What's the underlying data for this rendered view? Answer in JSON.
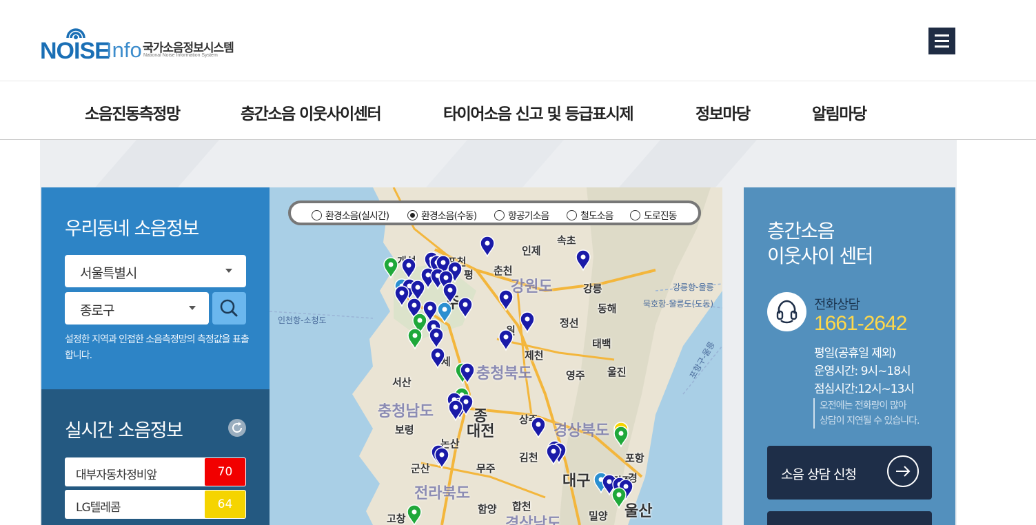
{
  "brand": {
    "logo_noise": "NOISE",
    "logo_info": "Info",
    "logo_ko": "국가소음정보시스템",
    "logo_en": "National Noise Information System"
  },
  "nav": {
    "items": [
      "소음진동측정망",
      "층간소음 이웃사이센터",
      "타이어소음 신고 및 등급표시제",
      "정보마당",
      "알림마당"
    ]
  },
  "local": {
    "title": "우리동네 소음정보",
    "city_select": "서울특별시",
    "district_select": "종로구",
    "help_text": "설정한 지역과 인접한 소음측정망의 측정값을 표출합니다."
  },
  "realtime": {
    "title": "실시간 소음정보",
    "rows": [
      {
        "name": "대부자동차정비앞",
        "value": "70",
        "color": "#f20000"
      },
      {
        "name": "LG텔레콤",
        "value": "64",
        "color": "#f5d400"
      }
    ]
  },
  "map": {
    "options": [
      "환경소음(실시간)",
      "환경소음(수동)",
      "항공기소음",
      "철도소음",
      "도로진동"
    ],
    "selected_option": "환경소음(수동)",
    "places": [
      "개성",
      "포천",
      "춘천",
      "인제",
      "속초",
      "강릉",
      "동해",
      "원",
      "정선",
      "태백",
      "제천",
      "영주",
      "울진",
      "서산",
      "보령",
      "논산",
      "상주",
      "대전",
      "김천",
      "포항",
      "대구",
      "군산",
      "무주",
      "함양",
      "합천",
      "밀양",
      "울산",
      "경주",
      "고창"
    ],
    "regions": [
      "강원도",
      "충청북도",
      "충청남도",
      "경상북도",
      "전라북도",
      "경상남도"
    ],
    "sea_routes": [
      "인천항-소청도",
      "강릉항-울릉",
      "묵호항-울릉도(도동)",
      "포항구-울릉"
    ],
    "label_fragments": [
      "평",
      "종",
      "세",
      "주",
      "경"
    ]
  },
  "center": {
    "title_line1": "층간소음",
    "title_line2": "이웃사이 센터",
    "phone_label": "전화상담",
    "phone": "1661-2642",
    "hours": [
      "평일(공휴일 제외)",
      "운영시간: 9시~18시",
      "점심시간:12시~13시"
    ],
    "note": [
      "오전에는 전화량이 많아",
      "상담이 지연될 수 있습니다."
    ],
    "cta_label": "소음 상담 신청"
  },
  "colors": {
    "primary_blue": "#2d84c6",
    "dark_blue": "#245981",
    "panel_blue": "#5390bd",
    "navy": "#1e2e48",
    "accent_yellow": "#ffd84a"
  }
}
